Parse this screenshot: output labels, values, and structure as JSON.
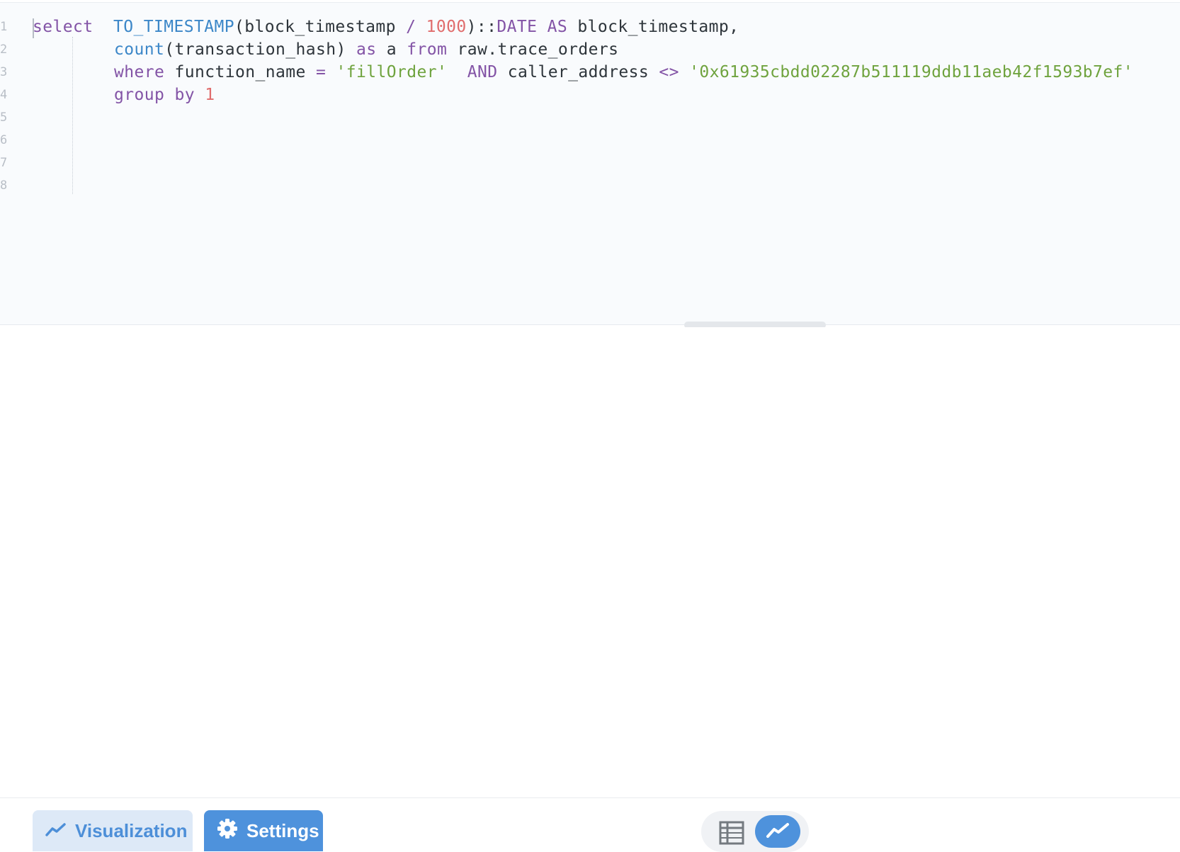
{
  "editor": {
    "line_numbers": [
      "1",
      "2",
      "3",
      "4",
      "5",
      "6",
      "7",
      "8"
    ],
    "lines": [
      [
        {
          "t": "select",
          "c": "kw"
        },
        {
          "t": "  ",
          "c": ""
        },
        {
          "t": "TO_TIMESTAMP",
          "c": "fn"
        },
        {
          "t": "(block_timestamp ",
          "c": ""
        },
        {
          "t": "/",
          "c": "op"
        },
        {
          "t": " ",
          "c": ""
        },
        {
          "t": "1000",
          "c": "num"
        },
        {
          "t": ")::",
          "c": ""
        },
        {
          "t": "DATE",
          "c": "kw"
        },
        {
          "t": " ",
          "c": ""
        },
        {
          "t": "AS",
          "c": "kw"
        },
        {
          "t": " block_timestamp,",
          "c": ""
        }
      ],
      [
        {
          "t": "count",
          "c": "fn"
        },
        {
          "t": "(transaction_hash) ",
          "c": ""
        },
        {
          "t": "as",
          "c": "kw"
        },
        {
          "t": " a ",
          "c": ""
        },
        {
          "t": "from",
          "c": "kw"
        },
        {
          "t": " raw.trace_orders",
          "c": ""
        }
      ],
      [
        {
          "t": "where",
          "c": "kw"
        },
        {
          "t": " function_name ",
          "c": ""
        },
        {
          "t": "=",
          "c": "op"
        },
        {
          "t": " ",
          "c": ""
        },
        {
          "t": "'fillOrder'",
          "c": "str"
        },
        {
          "t": "  ",
          "c": ""
        },
        {
          "t": "AND",
          "c": "kw"
        },
        {
          "t": " caller_address ",
          "c": ""
        },
        {
          "t": "<>",
          "c": "op"
        },
        {
          "t": " ",
          "c": ""
        },
        {
          "t": "'0x61935cbdd02287b511119ddb11aeb42f1593b7ef'",
          "c": "str"
        }
      ],
      [
        {
          "t": "group",
          "c": "kw"
        },
        {
          "t": " ",
          "c": ""
        },
        {
          "t": "by",
          "c": "kw"
        },
        {
          "t": " ",
          "c": ""
        },
        {
          "t": "1",
          "c": "num"
        }
      ]
    ]
  },
  "footer": {
    "visualization_label": "Visualization",
    "settings_label": "Settings",
    "view_toggle": {
      "options": [
        "table-view",
        "chart-view"
      ],
      "selected": "chart-view"
    }
  },
  "colors": {
    "keyword": "#8354a6",
    "function": "#3c87c8",
    "number": "#e06c6c",
    "string": "#6fa33e",
    "accent": "#4e92dc"
  },
  "icons": {
    "visualization": "line-chart-icon",
    "settings": "gear-icon",
    "table_toggle": "table-icon",
    "chart_toggle": "line-chart-icon"
  }
}
